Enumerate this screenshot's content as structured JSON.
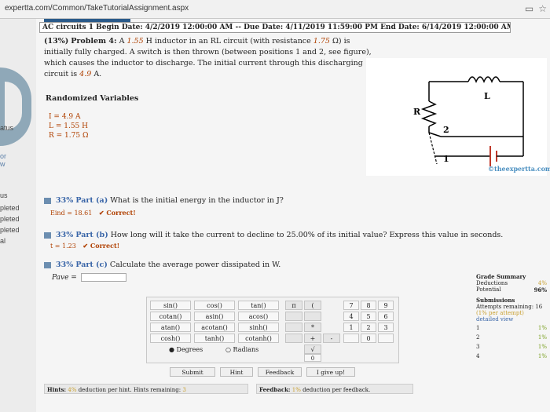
{
  "browser": {
    "url": "expertta.com/Common/TakeTutorialAssignment.aspx"
  },
  "sidebar": {
    "labels": [
      "atus",
      "or",
      "w",
      "us",
      "pleted",
      "pleted",
      "pleted",
      "al"
    ]
  },
  "header": {
    "assignment_line": "AC circuits 1 Begin Date: 4/2/2019 12:00:00 AM -- Due Date: 4/11/2019 11:59:00 PM End Date: 6/14/2019 12:00:00 AM"
  },
  "problem": {
    "weight": "(13%)",
    "label": "Problem 4:",
    "text_a": "A",
    "L": "1.55",
    "text_b": "H inductor in an RL circuit (with resistance",
    "R": "1.75",
    "text_c": "Ω) is initially fully charged. A switch is then thrown (between positions 1 and 2, see figure), which causes the inductor to discharge. The initial current through this discharging circuit is",
    "I": "4.9",
    "unit": "A."
  },
  "randomized": {
    "title": "Randomized Variables",
    "vars": [
      "I = 4.9 A",
      "L = 1.55 H",
      "R = 1.75 Ω"
    ]
  },
  "figure": {
    "R": "R",
    "L": "L",
    "pos2": "2",
    "pos1": "1",
    "credit": "©theexpertta.com"
  },
  "parts": {
    "a": {
      "pct": "33%",
      "label": "Part (a)",
      "question": "What is the initial energy in the inductor in J?",
      "answer": "Eind = 18.61",
      "status": "✔ Correct!"
    },
    "b": {
      "pct": "33%",
      "label": "Part (b)",
      "question": "How long will it take the current to decline to 25.00% of its initial value? Express this value in seconds.",
      "answer": "t = 1.23",
      "status": "✔ Correct!"
    },
    "c": {
      "pct": "33%",
      "label": "Part (c)",
      "question": "Calculate the average power dissipated in W."
    }
  },
  "input": {
    "label": "Pave ="
  },
  "calculator": {
    "funcs": [
      [
        "sin()",
        "cos()",
        "tan()"
      ],
      [
        "cotan()",
        "asin()",
        "acos()"
      ],
      [
        "atan()",
        "acotan()",
        "sinh()"
      ],
      [
        "cosh()",
        "tanh()",
        "cotanh()"
      ]
    ],
    "ops": [
      "π",
      "(",
      "",
      "",
      "",
      "*",
      "",
      "+",
      "-",
      "√"
    ],
    "digits": [
      [
        "7",
        "8",
        "9"
      ],
      [
        "4",
        "5",
        "6"
      ],
      [
        "1",
        "2",
        "3"
      ],
      [
        "",
        "0",
        ""
      ]
    ],
    "degrees": "Degrees",
    "radians": "Radians",
    "zero": "0",
    "submit": "Submit",
    "hint": "Hint",
    "feedback": "Feedback",
    "giveup": "I give up!"
  },
  "summary": {
    "title": "Grade Summary",
    "deductions_label": "Deductions",
    "deductions_value": "4%",
    "potential_label": "Potential",
    "potential_value": "96%",
    "submissions_title": "Submissions",
    "attempts": "Attempts remaining: 16",
    "per_attempt": "(1% per attempt)",
    "detailed": "detailed view",
    "rows": [
      {
        "n": "1",
        "v": "1%"
      },
      {
        "n": "2",
        "v": "1%"
      },
      {
        "n": "3",
        "v": "1%"
      },
      {
        "n": "4",
        "v": "1%"
      }
    ]
  },
  "footer": {
    "hints": "Hints:",
    "hints_pct": "4%",
    "hints_text": "deduction per hint. Hints remaining:",
    "hints_remaining": "3",
    "feedback": "Feedback:",
    "feedback_pct": "1%",
    "feedback_text": "deduction per feedback."
  },
  "colors": {
    "accent": "#3a66a8",
    "variable": "#b04000",
    "gold": "#c9a030",
    "green": "#7aa020"
  }
}
